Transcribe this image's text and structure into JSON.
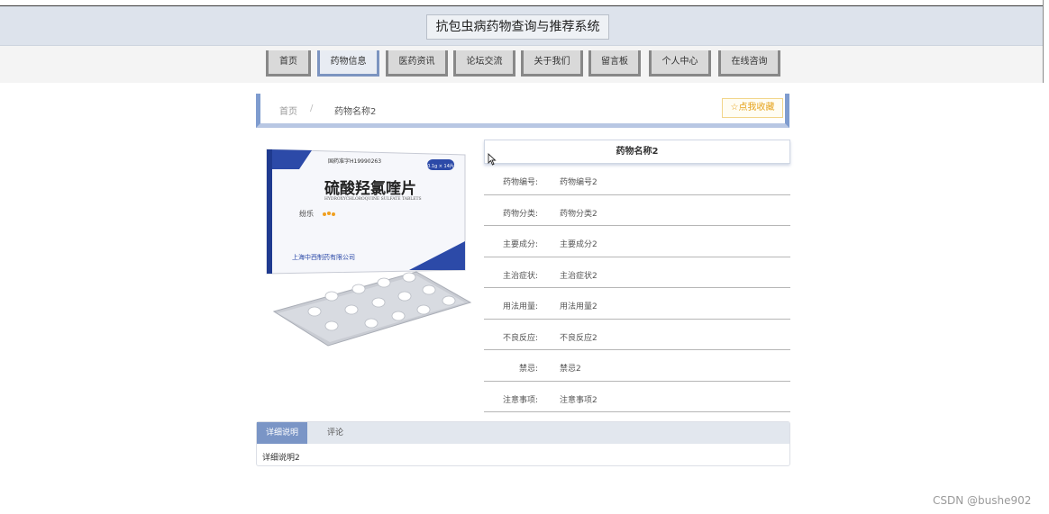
{
  "header": {
    "title": "抗包虫病药物查询与推荐系统"
  },
  "nav": [
    {
      "label": "首页"
    },
    {
      "label": "药物信息"
    },
    {
      "label": "医药资讯"
    },
    {
      "label": "论坛交流"
    },
    {
      "label": "关于我们"
    },
    {
      "label": "留言板"
    },
    {
      "label": "个人中心"
    },
    {
      "label": "在线咨询"
    }
  ],
  "breadcrumb": {
    "home": "首页",
    "separator": "/",
    "current": "药物名称2"
  },
  "favorite": {
    "label": "点我收藏",
    "icon": "star-icon"
  },
  "product_image": {
    "approval_no": "国药准字H19990263",
    "spec": "0.1g × 14片",
    "name_cn": "硫酸羟氯喹片",
    "name_en": "HYDROXYCHLOROQUINE SULFATE TABLETS",
    "brand": "纷乐",
    "maker": "上海中西制药有限公司"
  },
  "detail": {
    "title": "药物名称2",
    "rows": [
      {
        "label": "药物编号:",
        "value": "药物编号2"
      },
      {
        "label": "药物分类:",
        "value": "药物分类2"
      },
      {
        "label": "主要成分:",
        "value": "主要成分2"
      },
      {
        "label": "主治症状:",
        "value": "主治症状2"
      },
      {
        "label": "用法用量:",
        "value": "用法用量2"
      },
      {
        "label": "不良反应:",
        "value": "不良反应2"
      },
      {
        "label": "禁忌:",
        "value": "禁忌2"
      },
      {
        "label": "注意事项:",
        "value": "注意事项2"
      }
    ]
  },
  "tabs": {
    "items": [
      {
        "label": "详细说明"
      },
      {
        "label": "评论"
      }
    ],
    "content": "详细说明2"
  },
  "watermark": "CSDN @bushe902",
  "colors": {
    "accent": "#7a95c6",
    "header_bg": "#dde3ec",
    "favorite": "#e5a21a",
    "box_blue": "#2c4aa8"
  }
}
